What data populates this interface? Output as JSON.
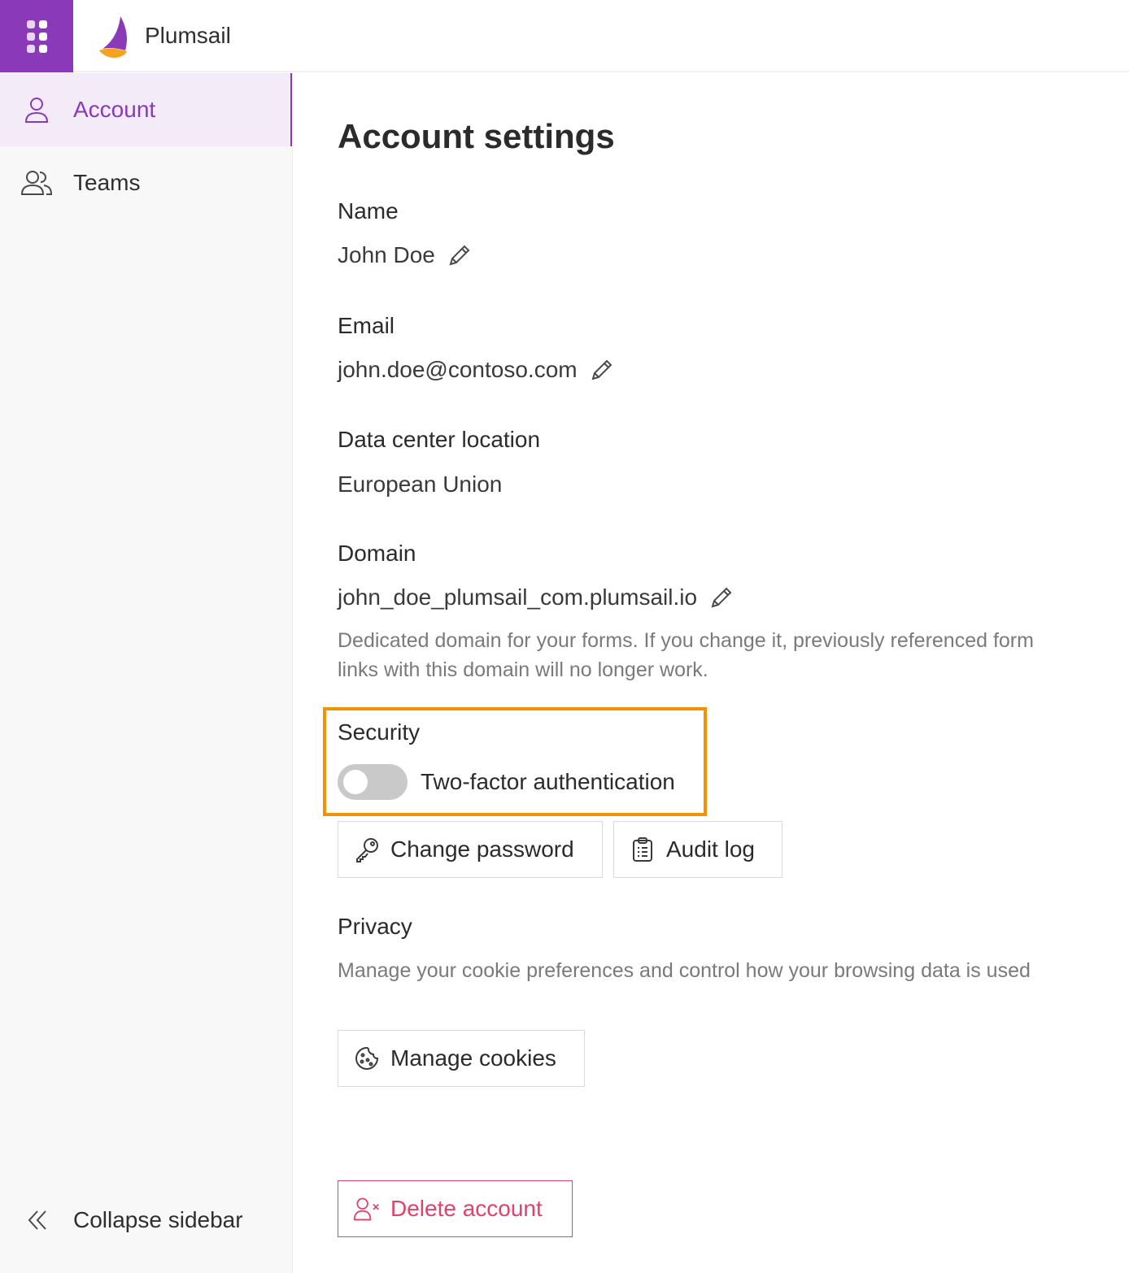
{
  "app": {
    "name": "Plumsail"
  },
  "sidebar": {
    "items": [
      {
        "label": "Account",
        "icon": "user-icon",
        "active": true
      },
      {
        "label": "Teams",
        "icon": "users-icon",
        "active": false
      }
    ],
    "collapse_label": "Collapse sidebar"
  },
  "page": {
    "title": "Account settings",
    "name": {
      "label": "Name",
      "value": "John Doe"
    },
    "email": {
      "label": "Email",
      "value": "john.doe@contoso.com"
    },
    "datacenter": {
      "label": "Data center location",
      "value": "European Union"
    },
    "domain": {
      "label": "Domain",
      "value": "john_doe_plumsail_com.plumsail.io",
      "help": "Dedicated domain for your forms. If you change it, previously referenced form links with this domain will no longer work."
    },
    "security": {
      "label": "Security",
      "two_factor_label": "Two-factor authentication",
      "two_factor_enabled": false,
      "change_password_label": "Change password",
      "audit_log_label": "Audit log"
    },
    "privacy": {
      "label": "Privacy",
      "help": "Manage your cookie preferences and control how your browsing data is used",
      "manage_cookies_label": "Manage cookies"
    },
    "delete_account_label": "Delete account"
  },
  "colors": {
    "brand": "#8a3ab9",
    "highlight": "#f39200",
    "danger": "#e2426a",
    "toggle_off": "#c9c9c9"
  }
}
